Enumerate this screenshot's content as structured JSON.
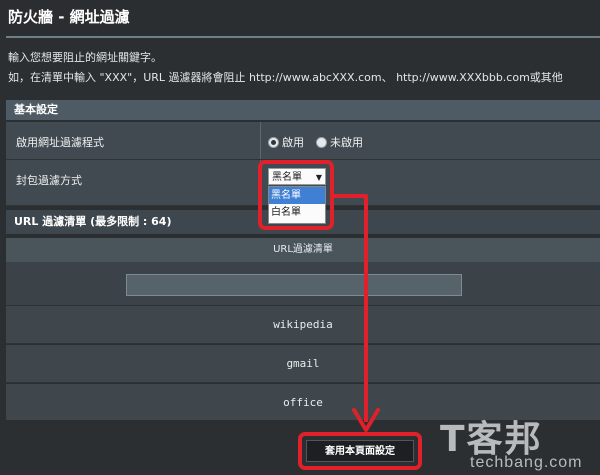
{
  "page": {
    "title": "防火牆 - 網址過濾",
    "description_line1": "輸入您想要阻止的網址關鍵字。",
    "description_line2": "如，在清單中輸入 \"XXX\"，URL 過濾器將會阻止 http://www.abcXXX.com、 http://www.XXXbbb.com或其他"
  },
  "basic_settings": {
    "header": "基本設定",
    "enable_label": "啟用網址過濾程式",
    "enable_options": [
      "啟用",
      "未啟用"
    ],
    "enable_selected": "啟用",
    "filter_mode_label": "封包過濾方式",
    "filter_mode_value": "黑名單",
    "filter_mode_options": [
      "黑名單",
      "白名單"
    ],
    "filter_mode_highlighted": "黑名單"
  },
  "url_list": {
    "header": "URL 過濾清單 (最多限制 : 64)",
    "column_header": "URL過濾清單",
    "input_value": "",
    "items": [
      "wikipedia",
      "gmail",
      "office"
    ]
  },
  "apply_button": "套用本頁面設定",
  "watermark": {
    "cjk": "T客邦",
    "latin": "techbang.com"
  },
  "colors": {
    "highlight": "#e0202a",
    "selected_option": "#3f7fd4"
  }
}
